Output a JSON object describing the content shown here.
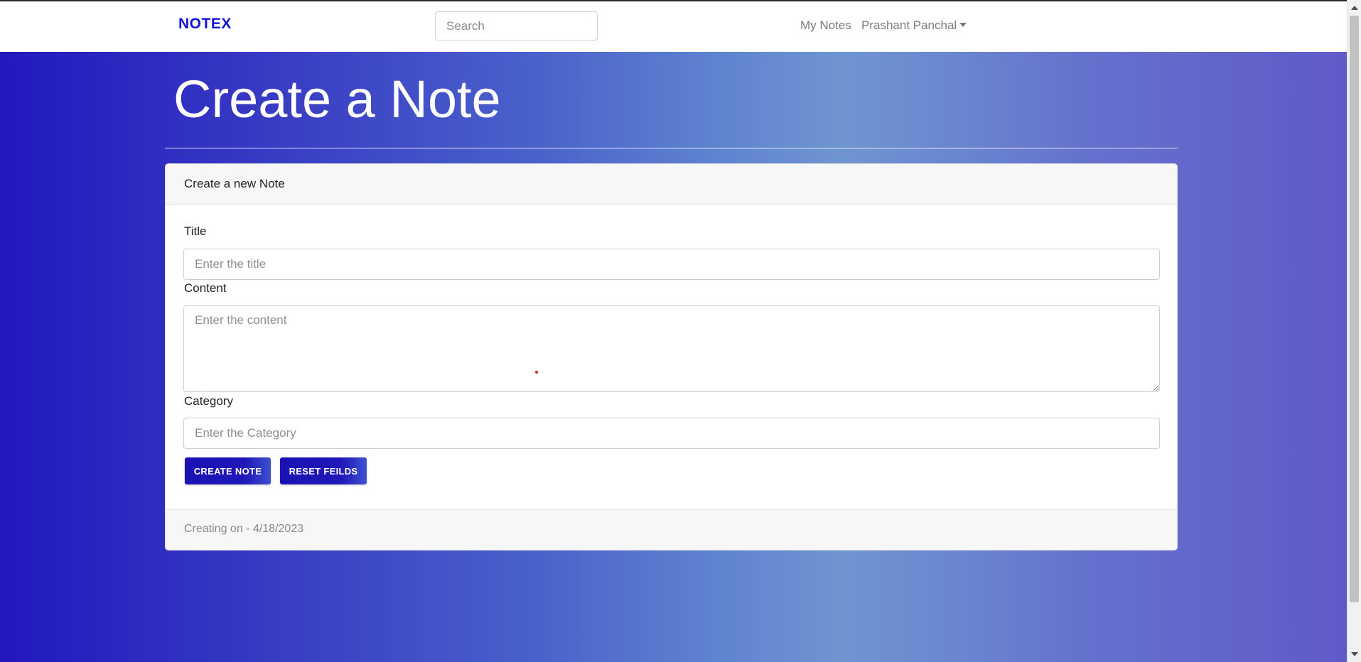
{
  "navbar": {
    "brand": "NOTEX",
    "search_placeholder": "Search",
    "links": {
      "my_notes": "My Notes",
      "user": "Prashant Panchal"
    }
  },
  "page": {
    "title": "Create a Note"
  },
  "card": {
    "header": "Create a new Note",
    "fields": {
      "title": {
        "label": "Title",
        "placeholder": "Enter the title",
        "value": ""
      },
      "content": {
        "label": "Content",
        "placeholder": "Enter the content",
        "value": ""
      },
      "category": {
        "label": "Category",
        "placeholder": "Enter the Category",
        "value": ""
      }
    },
    "buttons": {
      "create": "CREATE NOTE",
      "reset": "RESET FEILDS"
    },
    "footer": "Creating on - 4/18/2023"
  },
  "colors": {
    "brand": "#1414d6",
    "button": "#1c12b4",
    "gradient_start": "#2118be",
    "gradient_mid": "#6f95d1",
    "gradient_end": "#5f59c9"
  }
}
